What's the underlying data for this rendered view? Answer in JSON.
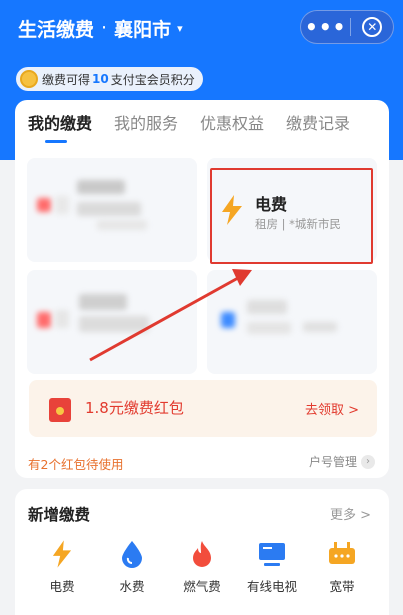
{
  "header": {
    "title": "生活缴费",
    "separator": "·",
    "city": "襄阳市",
    "caret": "▾",
    "more_label": "•••",
    "close_label": "✕"
  },
  "points": {
    "prefix": "缴费可得",
    "amount": "10",
    "suffix": "支付宝会员积分"
  },
  "tabs": [
    {
      "label": "我的缴费",
      "active": true
    },
    {
      "label": "我的服务",
      "active": false
    },
    {
      "label": "优惠权益",
      "active": false
    },
    {
      "label": "缴费记录",
      "active": false
    }
  ],
  "bills": {
    "electricity": {
      "title": "电费",
      "subtitle": "租房 | *城新市民"
    }
  },
  "red_packet": {
    "text": "1.8元缴费红包",
    "claim": "去领取 >"
  },
  "pending_text": "有2个红包待使用",
  "account_manage": "户号管理",
  "account_chevron": "›",
  "new_payment": {
    "title": "新增缴费",
    "more": "更多 >",
    "items": [
      {
        "label": "电费",
        "icon": "lightning-icon"
      },
      {
        "label": "水费",
        "icon": "water-drop-icon"
      },
      {
        "label": "燃气费",
        "icon": "flame-icon"
      },
      {
        "label": "有线电视",
        "icon": "tv-icon"
      },
      {
        "label": "宽带",
        "icon": "broadband-icon"
      }
    ]
  },
  "colors": {
    "primary": "#1677ff",
    "highlight_red": "#e03a30",
    "orange": "#f5a623"
  }
}
